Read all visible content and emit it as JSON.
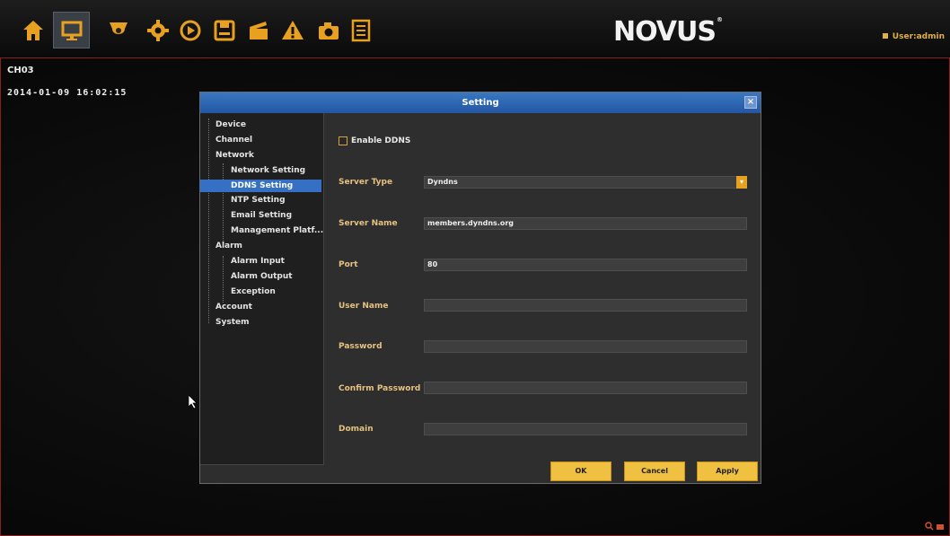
{
  "header": {
    "logo_text": "NOVUS",
    "logo_mark": "®",
    "user_label": "User:admin",
    "toolbar_icons": [
      "home-icon",
      "monitor-icon",
      "camera-icon",
      "gear-icon",
      "playback-icon",
      "save-icon",
      "clapper-icon",
      "warning-icon",
      "snapshot-icon",
      "log-icon"
    ],
    "accent_color": "#e8a020"
  },
  "overlay": {
    "channel": "CH03",
    "timestamp": "2014-01-09 16:02:15"
  },
  "dialog": {
    "title": "Setting",
    "close_label": "×",
    "tree": {
      "device": "Device",
      "channel": "Channel",
      "network": "Network",
      "network_setting": "Network Setting",
      "ddns_setting": "DDNS Setting",
      "ntp_setting": "NTP Setting",
      "email_setting": "Email Setting",
      "management_platform": "Management Platf...",
      "alarm": "Alarm",
      "alarm_input": "Alarm Input",
      "alarm_output": "Alarm Output",
      "exception": "Exception",
      "account": "Account",
      "system": "System"
    },
    "form": {
      "enable_ddns_label": "Enable DDNS",
      "server_type_label": "Server Type",
      "server_type_value": "Dyndns",
      "server_name_label": "Server Name",
      "server_name_value": "members.dyndns.org",
      "port_label": "Port",
      "port_value": "80",
      "user_name_label": "User Name",
      "user_name_value": "",
      "password_label": "Password",
      "password_value": "",
      "confirm_password_label": "Confirm Password",
      "confirm_password_value": "",
      "domain_label": "Domain",
      "domain_value": ""
    },
    "buttons": {
      "ok": "OK",
      "cancel": "Cancel",
      "apply": "Apply"
    }
  }
}
